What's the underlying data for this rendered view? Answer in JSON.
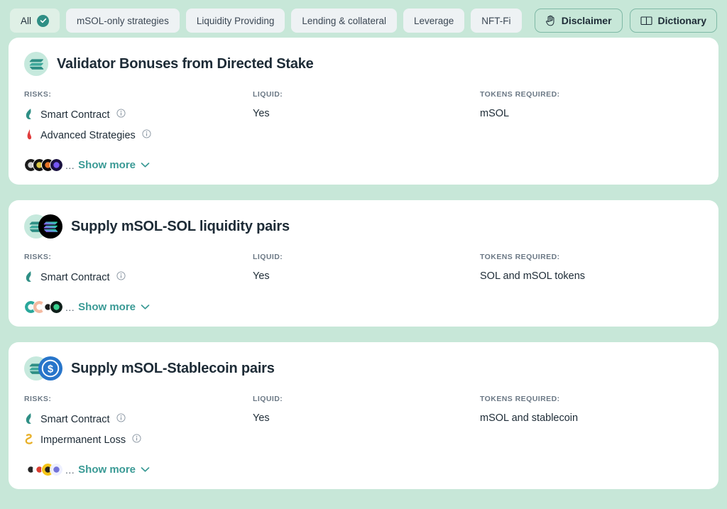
{
  "topbar": {
    "tabs": [
      {
        "label": "All",
        "active": true,
        "has_check": true
      },
      {
        "label": "mSOL-only strategies",
        "active": false,
        "has_check": false
      },
      {
        "label": "Liquidity Providing",
        "active": false,
        "has_check": false
      },
      {
        "label": "Lending & collateral",
        "active": false,
        "has_check": false
      },
      {
        "label": "Leverage",
        "active": false,
        "has_check": false
      },
      {
        "label": "NFT-Fi",
        "active": false,
        "has_check": false
      }
    ],
    "actions": [
      {
        "label": "Disclaimer",
        "icon": "hand-icon"
      },
      {
        "label": "Dictionary",
        "icon": "book-icon"
      }
    ]
  },
  "labels": {
    "risks": "RISKS:",
    "liquid": "LIQUID:",
    "tokens_required": "TOKENS REQUIRED:",
    "show_more": "Show more",
    "ellipsis": "..."
  },
  "colors": {
    "page_background": "#c7e7d8",
    "card_background": "#ffffff",
    "accent_teal": "#3a9a95",
    "check_badge": "#2f8f85",
    "tab_inactive": "#eef2f4",
    "tab_active": "#dff0e6",
    "button_border": "#7fb9a6",
    "text_primary": "#1d2b36",
    "text_muted": "#6b7885",
    "risk_smart_contract": "#2f8f85",
    "risk_advanced": "#e03b3b",
    "risk_impermanent": "#e8b028",
    "token_msol_bg": "#c6e9dd",
    "token_sol_bg": "#000000",
    "token_usdc_bg": "#2775ca"
  },
  "cards": [
    {
      "title": "Validator Bonuses from Directed Stake",
      "tokens": [
        "msol"
      ],
      "risks": [
        {
          "name": "Smart Contract",
          "icon": "risk-smart-contract-icon"
        },
        {
          "name": "Advanced Strategies",
          "icon": "risk-advanced-strategies-icon"
        }
      ],
      "liquid": "Yes",
      "tokens_required": "mSOL",
      "protocols": [
        {
          "bg": "#1b1b1b",
          "fg": "#d8d8d8"
        },
        {
          "bg": "#121212",
          "fg": "#e8d44a"
        },
        {
          "bg": "#0d0d0d",
          "fg": "#f07a2a"
        },
        {
          "bg": "#1a1140",
          "fg": "#7b5cff"
        }
      ]
    },
    {
      "title": "Supply mSOL-SOL liquidity pairs",
      "tokens": [
        "msol",
        "sol"
      ],
      "risks": [
        {
          "name": "Smart Contract",
          "icon": "risk-smart-contract-icon"
        }
      ],
      "liquid": "Yes",
      "tokens_required": "SOL and mSOL tokens",
      "protocols": [
        {
          "bg": "#2aa79b",
          "fg": "#ffffff"
        },
        {
          "bg": "#f4b9a0",
          "fg": "#ffffff"
        },
        {
          "bg": "#ffffff",
          "fg": "#111111"
        },
        {
          "bg": "#0f1f1a",
          "fg": "#3ddc97"
        }
      ]
    },
    {
      "title": "Supply mSOL-Stablecoin pairs",
      "tokens": [
        "msol",
        "usdc"
      ],
      "risks": [
        {
          "name": "Smart Contract",
          "icon": "risk-smart-contract-icon"
        },
        {
          "name": "Impermanent Loss",
          "icon": "risk-impermanent-loss-icon"
        }
      ],
      "liquid": "Yes",
      "tokens_required": "mSOL and stablecoin",
      "protocols": [
        {
          "bg": "#ffffff",
          "fg": "#1b1b1b"
        },
        {
          "bg": "#ffffff",
          "fg": "#d93025"
        },
        {
          "bg": "#f5c518",
          "fg": "#1b1b1b"
        },
        {
          "bg": "#eef0ff",
          "fg": "#6b6bd6"
        }
      ]
    }
  ]
}
